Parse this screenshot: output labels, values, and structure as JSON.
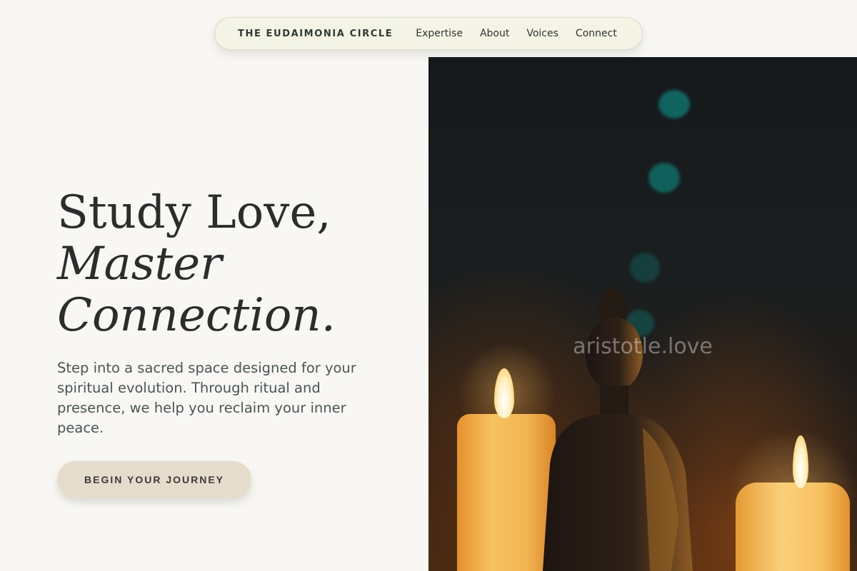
{
  "nav": {
    "brand": "THE EUDAIMONIA CIRCLE",
    "links": [
      "Expertise",
      "About",
      "Voices",
      "Connect"
    ]
  },
  "hero": {
    "title_line1": "Study Love,",
    "title_line2": "Master",
    "title_line3": "Connection.",
    "subtitle": "Step into a sacred space designed for your spiritual evolution. Through ritual and presence, we help you reclaim your inner peace.",
    "cta_label": "BEGIN YOUR JOURNEY"
  },
  "image": {
    "watermark": "aristotle.love",
    "subject": "buddha statue with candles"
  },
  "colors": {
    "background": "#f8f7f3",
    "nav_bg": "#f3f3e6",
    "cta_bg": "#e5dccb",
    "accent_teal": "#0e7d76"
  }
}
